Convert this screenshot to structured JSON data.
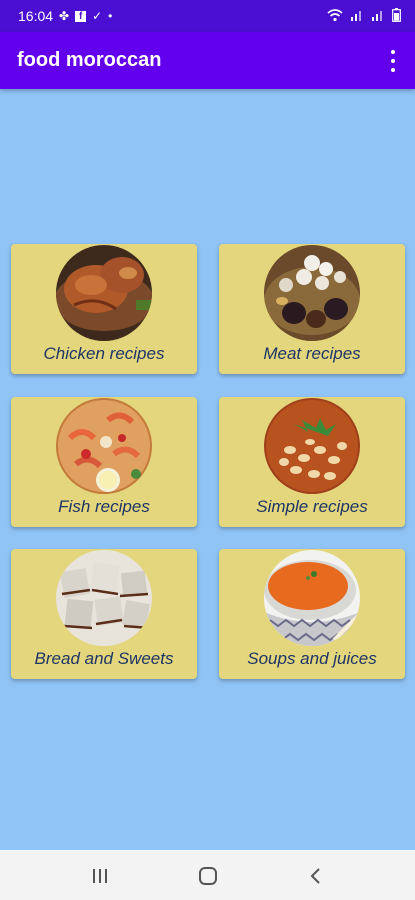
{
  "status_bar": {
    "time": "16:04",
    "left_icons": [
      "flower-icon",
      "facebook-icon",
      "check-icon",
      "dot-icon"
    ],
    "right_icons": [
      "wifi-icon",
      "signal-icon",
      "signal-icon",
      "battery-icon"
    ]
  },
  "app_bar": {
    "title": "food moroccan",
    "overflow_icon": "more-vertical-icon"
  },
  "categories": [
    {
      "label": "Chicken recipes",
      "image": "roast-chicken"
    },
    {
      "label": "Meat recipes",
      "image": "meat-with-prunes-eggs"
    },
    {
      "label": "Fish recipes",
      "image": "seafood-paella"
    },
    {
      "label": "Simple recipes",
      "image": "bean-stew"
    },
    {
      "label": "Bread and Sweets",
      "image": "layered-pastries"
    },
    {
      "label": "Soups and juices",
      "image": "soup-bowl"
    }
  ],
  "nav_bar": {
    "icons": [
      "recent-apps-icon",
      "home-icon",
      "back-icon"
    ]
  },
  "colors": {
    "status_bar": "#4a0fd0",
    "app_bar": "#6200ee",
    "background": "#90c4f7",
    "card": "#e3d67d",
    "card_text": "#1e3566"
  }
}
